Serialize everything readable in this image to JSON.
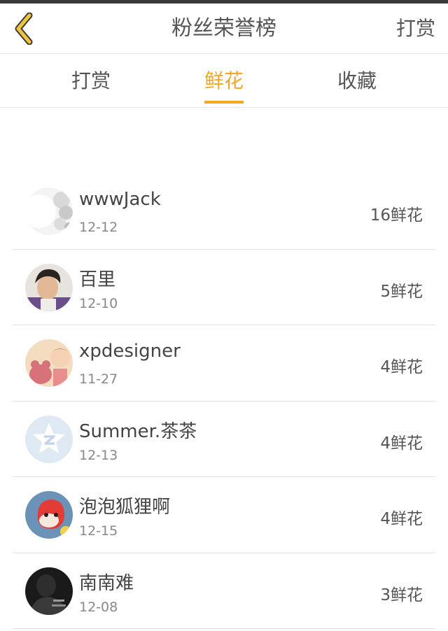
{
  "header": {
    "title": "粉丝荣誉榜",
    "action_label": "打赏",
    "back_icon": "chevron-left-icon"
  },
  "tabs": [
    {
      "label": "打赏",
      "active": false
    },
    {
      "label": "鲜花",
      "active": true
    },
    {
      "label": "收藏",
      "active": false
    }
  ],
  "colors": {
    "accent": "#f5a623",
    "back_icon": "#f0c53a"
  },
  "fans": [
    {
      "name": "wwwJack",
      "date": "12-12",
      "count": "16鲜花",
      "avatar": "avatar-photo-white-flowers"
    },
    {
      "name": "百里",
      "date": "12-10",
      "count": "5鲜花",
      "avatar": "avatar-photo-person"
    },
    {
      "name": "xpdesigner",
      "date": "11-27",
      "count": "4鲜花",
      "avatar": "avatar-photo-baby-bear"
    },
    {
      "name": "Summer.茶茶",
      "date": "12-13",
      "count": "4鲜花",
      "avatar": "avatar-qq-star-icon"
    },
    {
      "name": "泡泡狐狸啊",
      "date": "12-15",
      "count": "4鲜花",
      "avatar": "avatar-photo-cartoon"
    },
    {
      "name": "南南难",
      "date": "12-08",
      "count": "3鲜花",
      "avatar": "avatar-photo-dark"
    }
  ]
}
